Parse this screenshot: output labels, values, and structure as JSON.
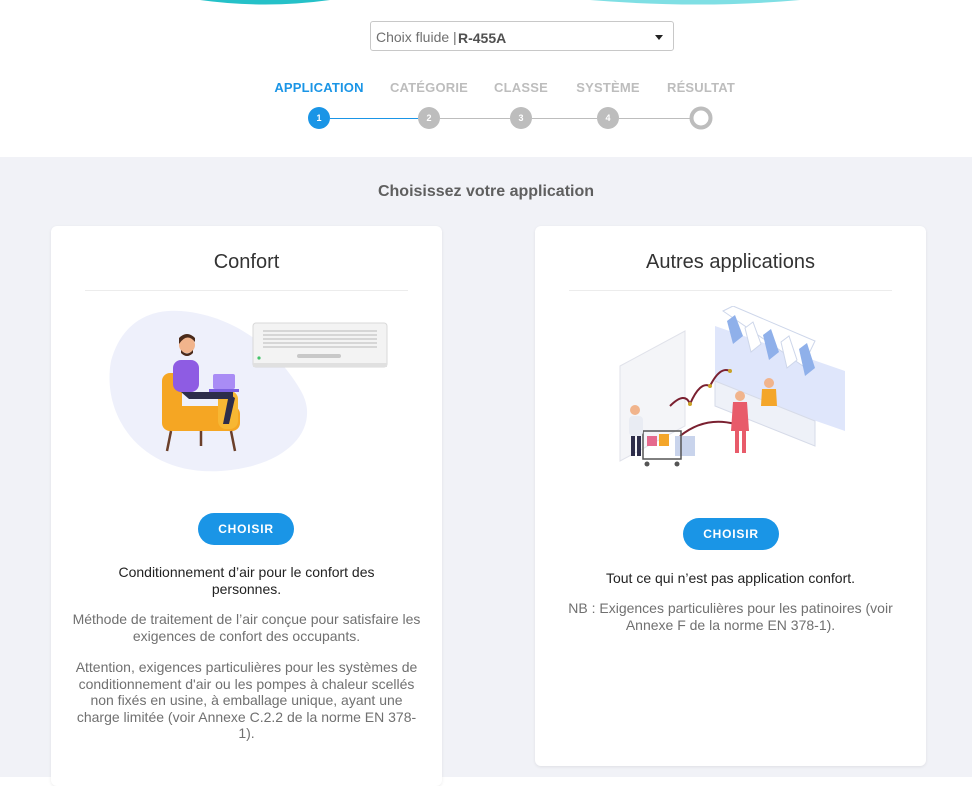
{
  "fluid_selector": {
    "label": "Choix fluide |",
    "value": "R-455A"
  },
  "steps": [
    {
      "label": "APPLICATION",
      "number": "1",
      "state": "active"
    },
    {
      "label": "CATÉGORIE",
      "number": "2",
      "state": "inactive"
    },
    {
      "label": "CLASSE",
      "number": "3",
      "state": "inactive"
    },
    {
      "label": "SYSTÈME",
      "number": "4",
      "state": "inactive"
    },
    {
      "label": "RÉSULTAT",
      "number": "",
      "state": "inactive"
    }
  ],
  "main": {
    "title": "Choisissez votre application",
    "cards": [
      {
        "title": "Confort",
        "button_label": "CHOISIR",
        "description": "Conditionnement d’air pour le confort des personnes.",
        "note1": "Méthode de traitement de l’air conçue pour satisfaire les exigences de confort des occupants.",
        "note2": "Attention, exigences particulières pour les systèmes de conditionnement d'air ou les pompes à chaleur scellés non fixés en usine, à emballage unique, ayant une charge limitée (voir Annexe C.2.2 de la norme EN 378-1)."
      },
      {
        "title": "Autres applications",
        "button_label": "CHOISIR",
        "description": "Tout ce qui n’est pas application confort.",
        "note1": "NB : Exigences particulières pour les patinoires (voir Annexe F de la norme EN 378-1)."
      }
    ]
  },
  "colors": {
    "accent": "#1a95e6",
    "inactive": "#bdbdbd",
    "background": "#f1f2f7"
  }
}
